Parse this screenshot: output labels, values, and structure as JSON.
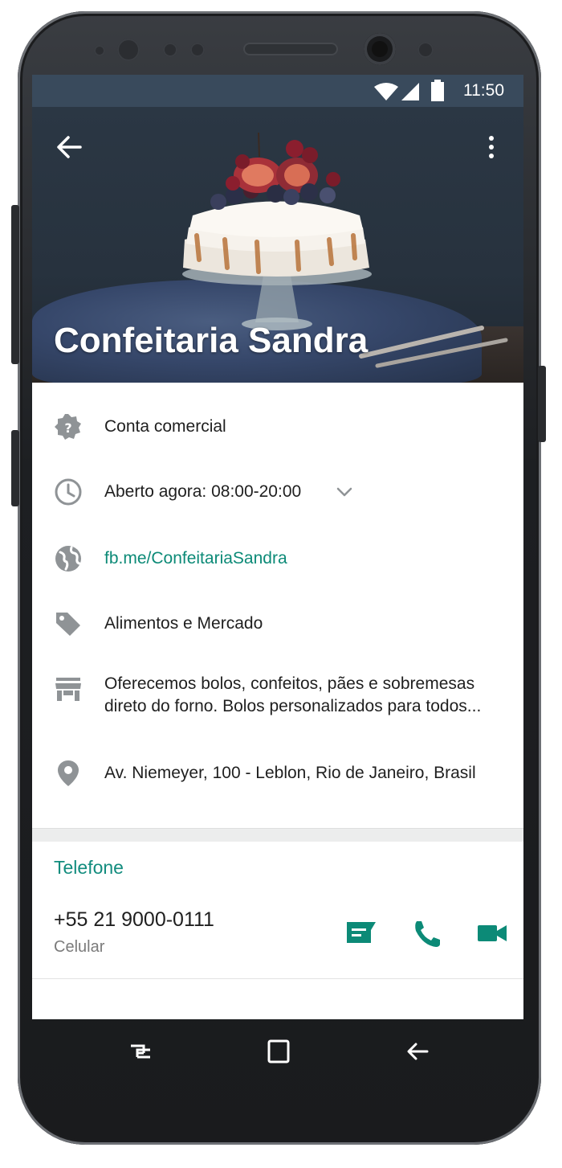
{
  "status_bar": {
    "time": "11:50",
    "icons": [
      "wifi-icon",
      "signal-icon",
      "battery-icon"
    ]
  },
  "header": {
    "business_name": "Confeitaria Sandra",
    "back_icon": "arrow-back-icon",
    "menu_icon": "more-vert-icon"
  },
  "info": [
    {
      "icon": "verified-badge-icon",
      "text": "Conta comercial"
    },
    {
      "icon": "clock-icon",
      "text": "Aberto agora: 08:00-20:00"
    },
    {
      "icon": "globe-icon",
      "text": "fb.me/ConfeitariaSandra"
    },
    {
      "icon": "tag-icon",
      "text": "Alimentos e Mercado"
    },
    {
      "icon": "store-icon",
      "text_line1": "Oferecemos bolos, confeitos, pães e sobremesas",
      "text_line2": "direto do forno. Bolos personalizados para todos..."
    },
    {
      "icon": "location-pin-icon",
      "text": "Av. Niemeyer, 100 - Leblon, Rio de Janeiro, Brasil"
    }
  ],
  "phone_section": {
    "title": "Telefone",
    "number": "+55 21 9000-0111",
    "type": "Celular",
    "actions": [
      "message-icon",
      "call-icon",
      "video-call-icon"
    ]
  },
  "colors": {
    "accent": "#128c7e",
    "link": "#0c8a77",
    "status_bar": "#394a5c",
    "icon_gray": "#8f9396"
  },
  "nav_bar": {
    "buttons": [
      "recents-icon",
      "home-icon",
      "back-nav-icon"
    ]
  }
}
